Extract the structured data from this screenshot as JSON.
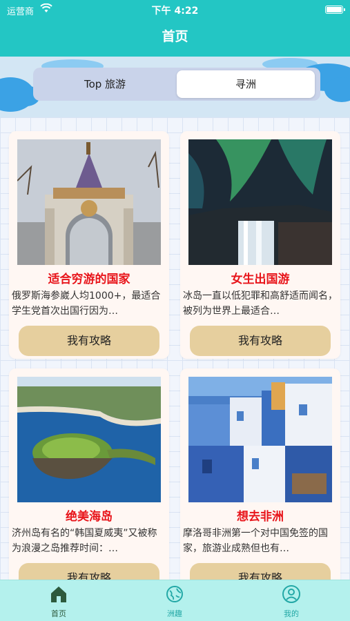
{
  "status_bar": {
    "carrier": "运营商",
    "time": "下午 4:22"
  },
  "nav": {
    "title": "首页"
  },
  "segments": [
    {
      "label": "Top 旅游",
      "selected": false
    },
    {
      "label": "寻洲",
      "selected": true
    }
  ],
  "cards": [
    {
      "title": "适合穷游的国家",
      "desc": "俄罗斯海参崴人均1000+，最适合学生党首次出国行因为…",
      "button": "我有攻略",
      "image": "russian-gate-photo"
    },
    {
      "title": "女生出国游",
      "desc": "冰岛一直以低犯罪和高舒适而闻名，被列为世界上最适合…",
      "button": "我有攻略",
      "image": "iceland-aurora-waterfall-photo"
    },
    {
      "title": "绝美海岛",
      "desc": "济州岛有名的“韩国夏威夷”又被称为浪漫之岛推荐时间：…",
      "button": "我有攻略",
      "image": "jeju-island-photo"
    },
    {
      "title": "想去非洲",
      "desc": "摩洛哥非洲第一个对中国免签的国家，旅游业成熟但也有…",
      "button": "我有攻略",
      "image": "chefchaouen-blue-city-photo"
    }
  ],
  "tabbar": [
    {
      "label": "首页",
      "icon": "home-icon",
      "active": true
    },
    {
      "label": "洲趣",
      "icon": "globe-icon",
      "active": false
    },
    {
      "label": "我的",
      "icon": "user-icon",
      "active": false
    }
  ],
  "colors": {
    "primary": "#23c6c4",
    "title_red": "#e8141a",
    "button_tan": "#e6cf9e",
    "tabbar_bg": "#b4f1ed"
  }
}
